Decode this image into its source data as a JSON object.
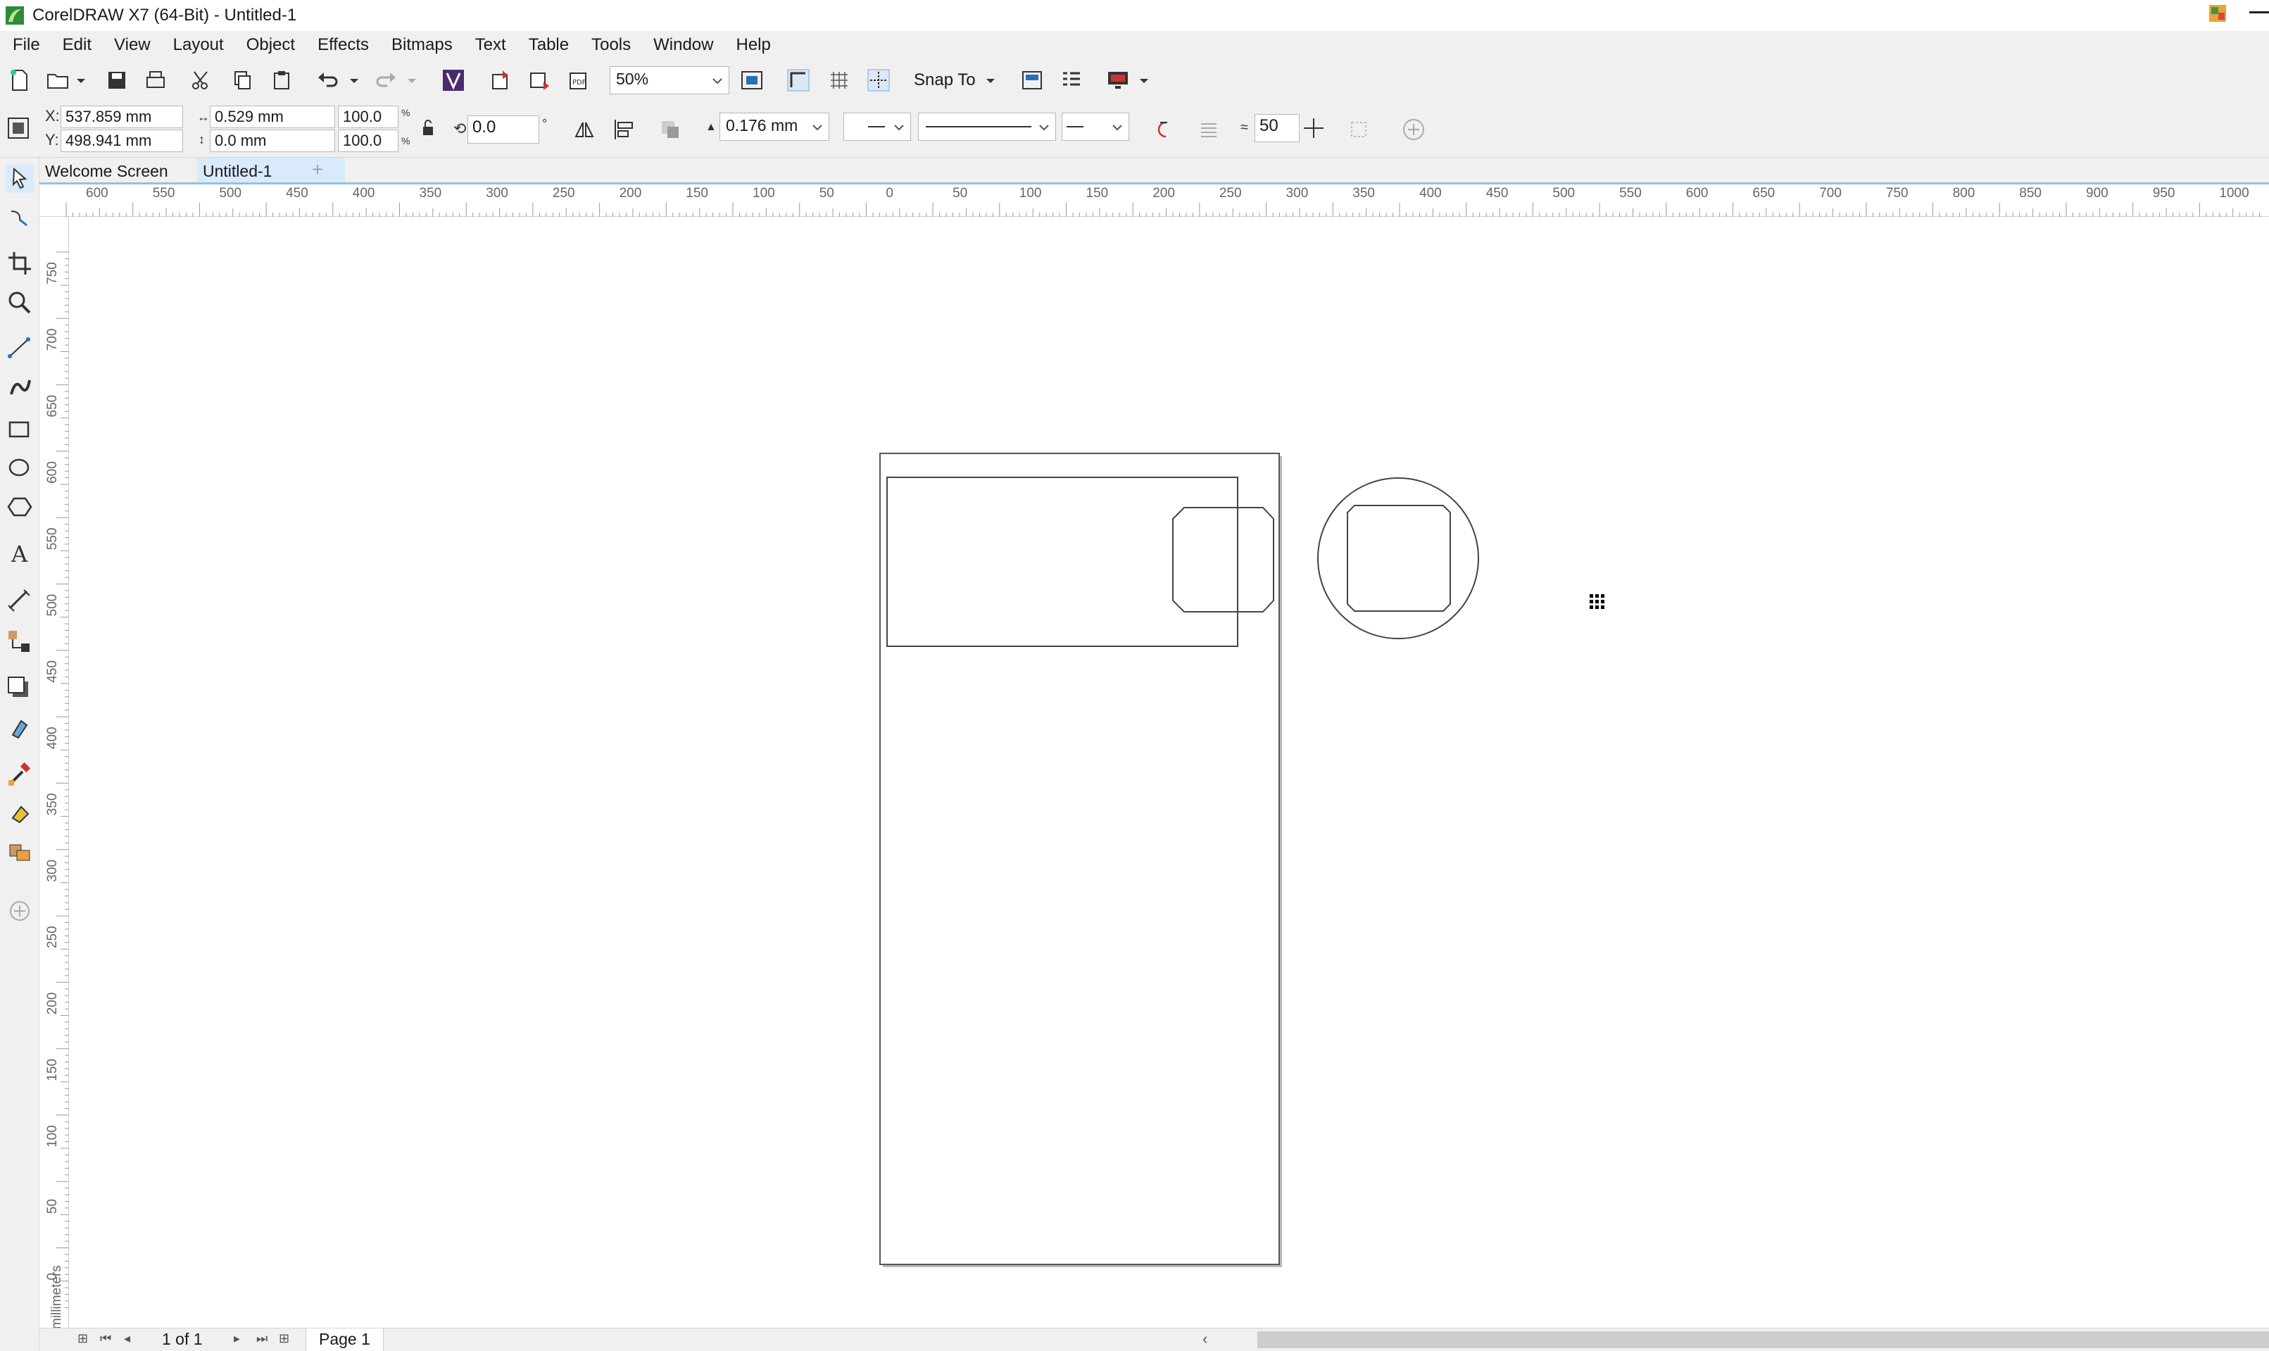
{
  "window": {
    "title": "CorelDRAW X7 (64-Bit) - Untitled-1"
  },
  "menu": [
    "File",
    "Edit",
    "View",
    "Layout",
    "Object",
    "Effects",
    "Bitmaps",
    "Text",
    "Table",
    "Tools",
    "Window",
    "Help"
  ],
  "toolbar": {
    "zoom_value": "50%",
    "snap_to_label": "Snap To"
  },
  "property_bar": {
    "x_label": "X:",
    "x_value": "537.859 mm",
    "y_label": "Y:",
    "y_value": "498.941 mm",
    "width_value": "0.529 mm",
    "height_value": "0.0 mm",
    "scale_x": "100.0",
    "scale_y": "100.0",
    "percent_symbol": "%",
    "angle_value": "0.0",
    "degree_symbol": "°",
    "outline_width": "0.176 mm",
    "smoothing_value": "50"
  },
  "tabs": [
    "Welcome Screen",
    "Untitled-1"
  ],
  "active_tab": "Untitled-1",
  "rulers": {
    "horizontal_ticks": [
      "600",
      "550",
      "500",
      "450",
      "400",
      "350",
      "300",
      "250",
      "200",
      "150",
      "100",
      "50",
      "0",
      "50",
      "100",
      "150",
      "200",
      "250",
      "300",
      "350",
      "400",
      "450",
      "500",
      "550",
      "600",
      "650",
      "700",
      "750",
      "800",
      "850",
      "900",
      "950",
      "1000"
    ],
    "vertical_ticks": [
      "750",
      "700",
      "650",
      "600",
      "550",
      "500",
      "450",
      "400",
      "350",
      "300",
      "250",
      "200",
      "150",
      "100",
      "50",
      "0"
    ],
    "unit_label": "millimeters"
  },
  "status": {
    "page_count": "1 of 1",
    "page_tab": "Page 1"
  },
  "colors": {
    "chrome_bg": "#f0f0f0",
    "active_tab_bg": "#d9ebfa",
    "tab_underline": "#8fc2ea",
    "page_border": "#555555",
    "shape_stroke": "#444444"
  }
}
